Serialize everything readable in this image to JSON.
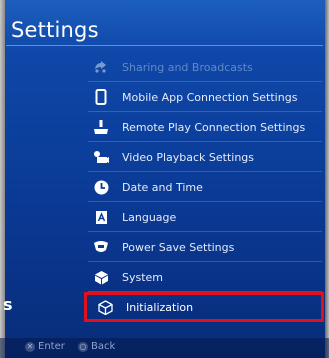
{
  "title": "Settings",
  "menu": [
    {
      "label": "Sharing and Broadcasts",
      "icon": "share-icon",
      "faded": true
    },
    {
      "label": "Mobile App Connection Settings",
      "icon": "smartphone-icon"
    },
    {
      "label": "Remote Play Connection Settings",
      "icon": "remote-play-icon"
    },
    {
      "label": "Video Playback Settings",
      "icon": "film-icon"
    },
    {
      "label": "Date and Time",
      "icon": "clock-icon"
    },
    {
      "label": "Language",
      "icon": "language-icon"
    },
    {
      "label": "Power Save Settings",
      "icon": "power-save-icon"
    },
    {
      "label": "System",
      "icon": "cube-icon"
    },
    {
      "label": "Initialization",
      "icon": "initialization-icon",
      "selected": true
    }
  ],
  "left_fragment": "s",
  "footer": {
    "enter_label": "Enter",
    "back_label": "Back"
  },
  "colors": {
    "background": "#0a3a95",
    "selection_outline": "#e0101c",
    "text": "#e4ecfb"
  }
}
